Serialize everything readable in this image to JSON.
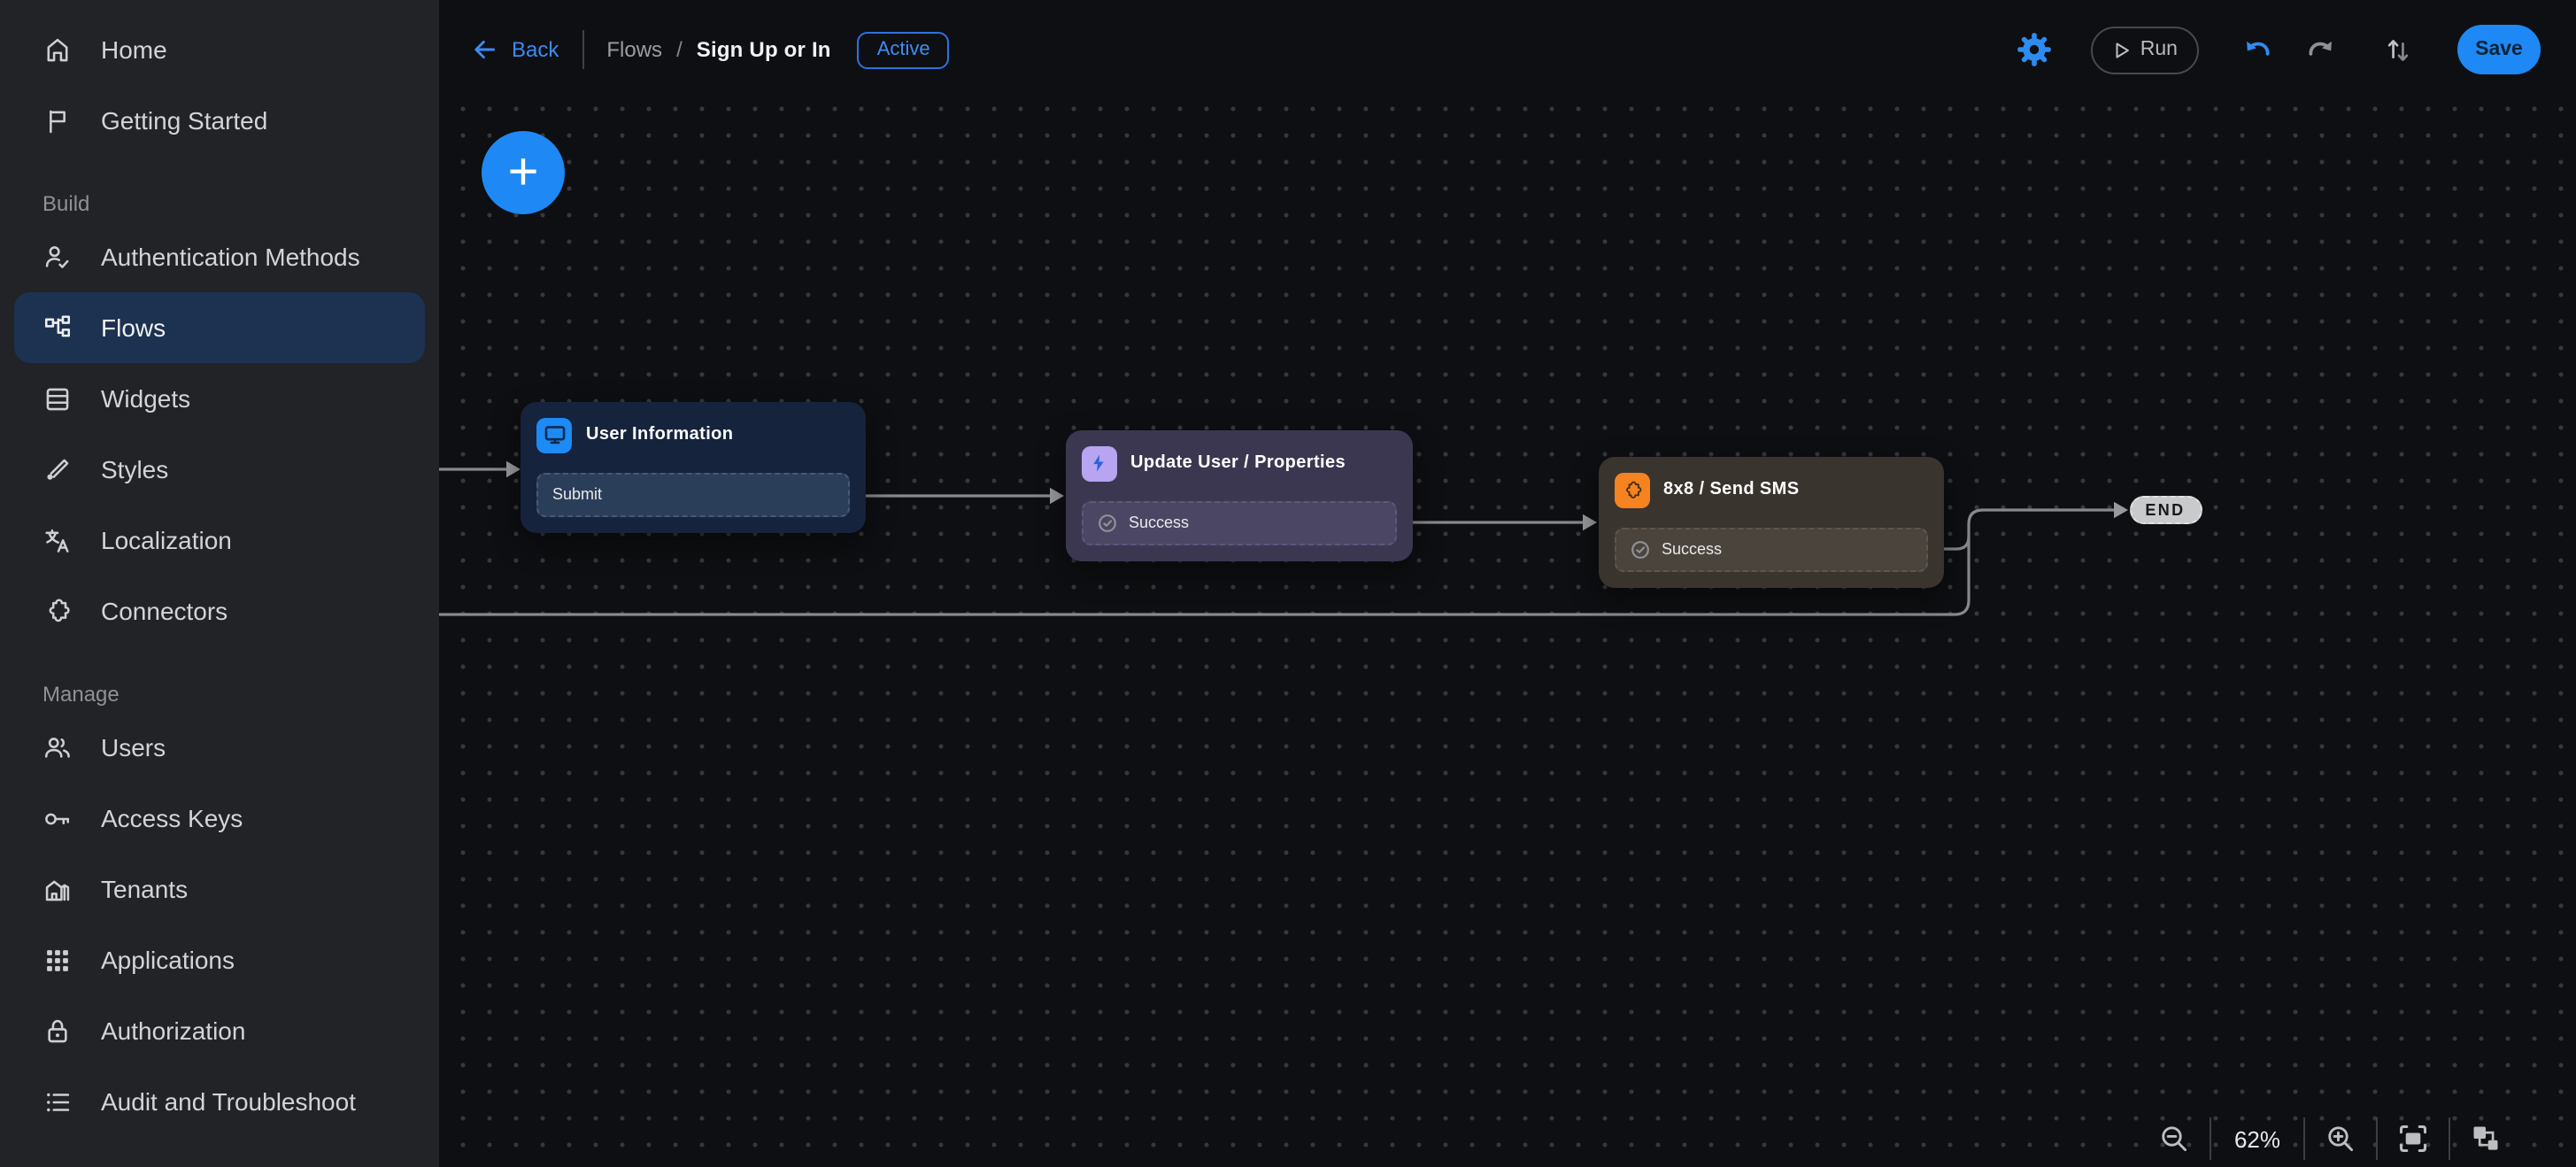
{
  "header": {
    "back_label": "Back",
    "breadcrumb": {
      "parent": "Flows",
      "separator": "/",
      "current": "Sign Up or In"
    },
    "status_badge": "Active",
    "run_label": "Run",
    "save_label": "Save"
  },
  "sidebar": {
    "sections": [
      {
        "items": [
          {
            "label": "Home",
            "icon": "home-icon"
          },
          {
            "label": "Getting Started",
            "icon": "flag-icon"
          }
        ]
      },
      {
        "label": "Build",
        "items": [
          {
            "label": "Authentication Methods",
            "icon": "person-check-icon"
          },
          {
            "label": "Flows",
            "icon": "flows-icon",
            "active": true
          },
          {
            "label": "Widgets",
            "icon": "widgets-icon"
          },
          {
            "label": "Styles",
            "icon": "brush-icon"
          },
          {
            "label": "Localization",
            "icon": "translate-icon"
          },
          {
            "label": "Connectors",
            "icon": "puzzle-icon"
          }
        ]
      },
      {
        "label": "Manage",
        "items": [
          {
            "label": "Users",
            "icon": "users-icon"
          },
          {
            "label": "Access Keys",
            "icon": "key-icon"
          },
          {
            "label": "Tenants",
            "icon": "buildings-icon"
          },
          {
            "label": "Applications",
            "icon": "apps-grid-icon"
          },
          {
            "label": "Authorization",
            "icon": "lock-icon"
          },
          {
            "label": "Audit and Troubleshoot",
            "icon": "list-icon"
          }
        ]
      }
    ]
  },
  "canvas": {
    "nodes": [
      {
        "title": "User Information",
        "icon": "screen-icon",
        "icon_bg": "#1d8af5",
        "outputs": [
          {
            "label": "Submit"
          }
        ]
      },
      {
        "title": "Update User / Properties",
        "icon": "bolt-icon",
        "icon_bg": "#b7a5f2",
        "outputs": [
          {
            "label": "Success"
          }
        ]
      },
      {
        "title": "8x8 / Send SMS",
        "icon": "connector-puzzle-icon",
        "icon_bg": "#f5831f",
        "outputs": [
          {
            "label": "Success"
          }
        ]
      }
    ],
    "end_label": "END",
    "zoom_level": "62%"
  },
  "colors": {
    "accent_blue": "#2d8cf0",
    "save_button_bg": "#1e88f5",
    "active_badge_blue": "#3f8df5",
    "selected_sidebar_item_bg": "#1d3150",
    "node_user_information_bg": "#15233c",
    "node_update_user_bg": "#3c3750",
    "node_send_sms_bg": "#3a342e",
    "end_node_bg": "#c9cacb",
    "canvas_bg": "#0e0f12",
    "sidebar_bg": "#212327",
    "wire_gray": "#87898c"
  }
}
